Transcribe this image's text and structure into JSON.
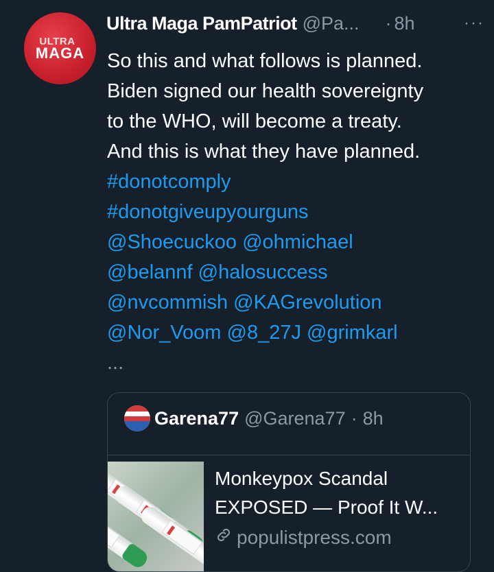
{
  "tweet": {
    "avatar_text_top": "ULTRA",
    "avatar_text_bottom": "MAGA",
    "display_name": "Ultra Maga PamPatriot",
    "handle": "@Pa...",
    "separator": "·",
    "time": "8h",
    "more": "···",
    "text_lines": [
      "So this and what follows is planned.",
      "Biden signed our health sovereignty",
      "to the WHO, will become a treaty.",
      "And this is what they have planned."
    ],
    "link_lines": [
      "#donotcomply",
      "#donotgiveupyourguns",
      "@Shoecuckoo @ohmichael",
      "@belannf @halosuccess",
      "@nvcommish @KAGrevolution",
      "@Nor_Voom @8_27J @grimkarl"
    ],
    "truncation": "..."
  },
  "quoted": {
    "display_name": "Garena77",
    "handle": "@Garena77",
    "separator": "·",
    "time": "8h",
    "card": {
      "title_line1": "Monkeypox Scandal",
      "title_line2": "EXPOSED — Proof It W...",
      "domain": "populistpress.com",
      "image": "monkeypox-vial-tubes-image",
      "domain_icon": "link-icon"
    }
  },
  "colors": {
    "background": "#15202b",
    "link": "#1d9bf0",
    "secondary_text": "#8b98a5",
    "border": "#38444d",
    "avatar_red": "#c8202c"
  }
}
